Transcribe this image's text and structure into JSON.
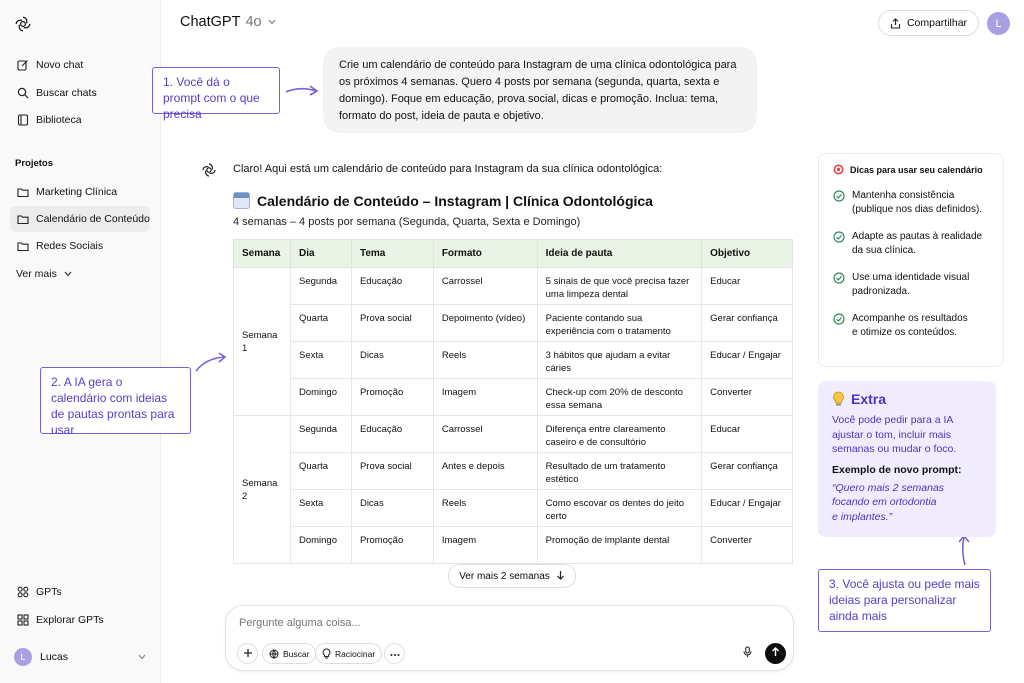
{
  "app": {
    "model_name": "ChatGPT",
    "model_version": "4o",
    "share_label": "Compartilhar",
    "user_initial": "L"
  },
  "sidebar": {
    "items": [
      {
        "label": "Novo chat",
        "icon": "edit-icon"
      },
      {
        "label": "Buscar chats",
        "icon": "search-icon"
      },
      {
        "label": "Biblioteca",
        "icon": "library-icon"
      }
    ],
    "projects_heading": "Projetos",
    "projects": [
      {
        "label": "Marketing Clínica",
        "icon": "folder-icon"
      },
      {
        "label": "Calendário de Conteúdo",
        "icon": "folder-icon",
        "active": true
      },
      {
        "label": "Redes Sociais",
        "icon": "folder-icon"
      }
    ],
    "see_more": "Ver mais",
    "gpts": "GPTs",
    "explore_gpts": "Explorar GPTs",
    "user_name": "Lucas",
    "user_initial": "L"
  },
  "user_message": "Crie um calendário de conteúdo para Instagram de uma clínica odontológica para os próximos 4 semanas. Quero 4 posts por semana (segunda, quarta, sexta e domingo). Foque em educação, prova social, dicas e promoção. Inclua: tema, formato do post, ideia de pauta e objetivo.",
  "annotations": {
    "a1": {
      "num": "1.",
      "text": "Você dá o prompt com o que precisa"
    },
    "a2": {
      "num": "2.",
      "text": "A IA gera o calendário com ideias de pautas prontas para usar"
    },
    "a3": {
      "num": "3.",
      "text": "Você ajusta ou pede mais ideias para personalizar ainda mais"
    }
  },
  "assistant": {
    "intro": "Claro! Aqui está um calendário de conteúdo para Instagram da sua clínica odontológica:",
    "title": "Calendário de Conteúdo – Instagram | Clínica Odontológica",
    "subtitle": "4 semanas – 4 posts por semana (Segunda, Quarta, Sexta e Domingo)"
  },
  "table": {
    "headers": [
      "Semana",
      "Dia",
      "Tema",
      "Formato",
      "Ideia de pauta",
      "Objetivo"
    ],
    "weeks": [
      {
        "label": "Semana 1",
        "rows": [
          {
            "dia": "Segunda",
            "tema": "Educação",
            "formato": "Carrossel",
            "ideia": "5 sinais de que você precisa fazer uma limpeza dental",
            "objetivo": "Educar"
          },
          {
            "dia": "Quarta",
            "tema": "Prova social",
            "formato": "Depoimento (vídeo)",
            "ideia": "Paciente contando sua experiência com o tratamento",
            "objetivo": "Gerar confiança"
          },
          {
            "dia": "Sexta",
            "tema": "Dicas",
            "formato": "Reels",
            "ideia": "3 hábitos que ajudam a evitar cáries",
            "objetivo": "Educar / Engajar"
          },
          {
            "dia": "Domingo",
            "tema": "Promoção",
            "formato": "Imagem",
            "ideia": "Check-up com 20% de desconto essa semana",
            "objetivo": "Converter"
          }
        ]
      },
      {
        "label": "Semana 2",
        "rows": [
          {
            "dia": "Segunda",
            "tema": "Educação",
            "formato": "Carrossel",
            "ideia": "Diferença entre clareamento caseiro e de consultório",
            "objetivo": "Educar"
          },
          {
            "dia": "Quarta",
            "tema": "Prova social",
            "formato": "Antes e depois",
            "ideia": "Resultado de um tratamento estético",
            "objetivo": "Gerar confiança"
          },
          {
            "dia": "Sexta",
            "tema": "Dicas",
            "formato": "Reels",
            "ideia": "Como escovar os dentes do jeito certo",
            "objetivo": "Educar / Engajar"
          },
          {
            "dia": "Domingo",
            "tema": "Promoção",
            "formato": "Imagem",
            "ideia": "Promoção de implante dental",
            "objetivo": "Converter"
          }
        ]
      }
    ]
  },
  "see_more_weeks": "Ver mais 2 semanas",
  "composer": {
    "placeholder": "Pergunte alguma coisa...",
    "search_label": "Buscar",
    "reason_label": "Raciocinar"
  },
  "tips": {
    "heading": "Dicas para usar seu calendário",
    "items": [
      "Mantenha consistência\n(publique nos dias definidos).",
      "Adapte as pautas à realidade\nda sua clínica.",
      "Use uma identidade visual\npadronizada.",
      "Acompanhe os resultados\ne otimize os conteúdos."
    ]
  },
  "extra": {
    "heading": "Extra",
    "body": "Você pode pedir para a IA\najustar o tom, incluir mais\nsemanas ou mudar o foco.",
    "example_label": "Exemplo de novo prompt:",
    "example": "“Quero mais 2 semanas\nfocando em ortodontia\ne implantes.”"
  },
  "colors": {
    "accent_purple": "#7b5fd6",
    "table_header_green": "#e9f3e6",
    "check_green": "#2e8b57"
  }
}
